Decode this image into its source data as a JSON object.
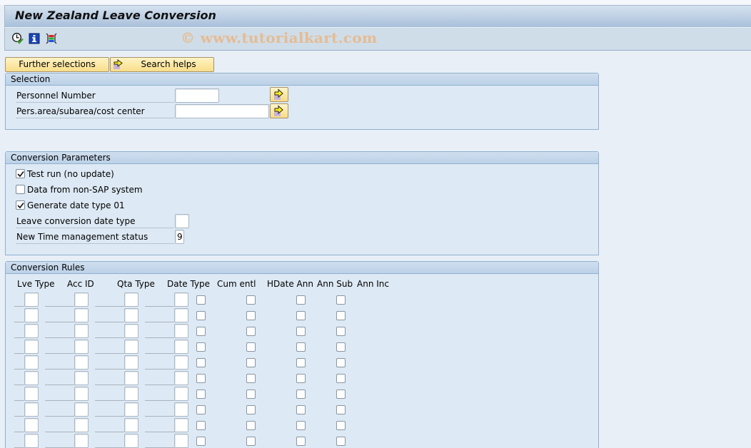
{
  "window": {
    "title": "New Zealand Leave Conversion",
    "watermark": "© www.tutorialkart.com"
  },
  "toolbar": {
    "icons": [
      {
        "name": "execute-icon",
        "tooltip": ""
      },
      {
        "name": "info-icon",
        "tooltip": ""
      },
      {
        "name": "selection-screen-icon",
        "tooltip": ""
      }
    ]
  },
  "buttons": {
    "further_selections": "Further selections",
    "search_helps": "Search helps"
  },
  "selection": {
    "title": "Selection",
    "fields": [
      {
        "label": "Personnel Number",
        "value": ""
      },
      {
        "label": "Pers.area/subarea/cost center",
        "value": ""
      }
    ]
  },
  "conversion_parameters": {
    "title": "Conversion Parameters",
    "checkboxes": [
      {
        "label": "Test run (no update)",
        "checked": true
      },
      {
        "label": "Data from non-SAP system",
        "checked": false
      },
      {
        "label": "Generate date type 01",
        "checked": true
      }
    ],
    "fields": [
      {
        "label": "Leave conversion date type",
        "value": ""
      },
      {
        "label": "New Time management status",
        "value": "9"
      }
    ]
  },
  "conversion_rules": {
    "title": "Conversion Rules",
    "columns": [
      "Lve Type",
      "Acc ID",
      "Qta Type",
      "Date Type",
      "Cum entl",
      "HDate Ann",
      "Ann Sub",
      "Ann Inc"
    ],
    "rows": [
      {
        "lve_type": "",
        "acc_id": "",
        "qta_type": "",
        "date_type": "",
        "cum_entl": false,
        "hdate_ann": false,
        "ann_sub": false,
        "ann_inc": false
      },
      {
        "lve_type": "",
        "acc_id": "",
        "qta_type": "",
        "date_type": "",
        "cum_entl": false,
        "hdate_ann": false,
        "ann_sub": false,
        "ann_inc": false
      },
      {
        "lve_type": "",
        "acc_id": "",
        "qta_type": "",
        "date_type": "",
        "cum_entl": false,
        "hdate_ann": false,
        "ann_sub": false,
        "ann_inc": false
      },
      {
        "lve_type": "",
        "acc_id": "",
        "qta_type": "",
        "date_type": "",
        "cum_entl": false,
        "hdate_ann": false,
        "ann_sub": false,
        "ann_inc": false
      },
      {
        "lve_type": "",
        "acc_id": "",
        "qta_type": "",
        "date_type": "",
        "cum_entl": false,
        "hdate_ann": false,
        "ann_sub": false,
        "ann_inc": false
      },
      {
        "lve_type": "",
        "acc_id": "",
        "qta_type": "",
        "date_type": "",
        "cum_entl": false,
        "hdate_ann": false,
        "ann_sub": false,
        "ann_inc": false
      },
      {
        "lve_type": "",
        "acc_id": "",
        "qta_type": "",
        "date_type": "",
        "cum_entl": false,
        "hdate_ann": false,
        "ann_sub": false,
        "ann_inc": false
      },
      {
        "lve_type": "",
        "acc_id": "",
        "qta_type": "",
        "date_type": "",
        "cum_entl": false,
        "hdate_ann": false,
        "ann_sub": false,
        "ann_inc": false
      },
      {
        "lve_type": "",
        "acc_id": "",
        "qta_type": "",
        "date_type": "",
        "cum_entl": false,
        "hdate_ann": false,
        "ann_sub": false,
        "ann_inc": false
      },
      {
        "lve_type": "",
        "acc_id": "",
        "qta_type": "",
        "date_type": "",
        "cum_entl": false,
        "hdate_ann": false,
        "ann_sub": false,
        "ann_inc": false
      }
    ]
  },
  "colors": {
    "title_gradient_top": "#d5e2ef",
    "title_gradient_bottom": "#a9c0da",
    "toolbar_bg": "#cfdde9",
    "page_bg": "#e8eff7",
    "group_bg": "#dde9f4",
    "button_yellow": "#f8de8a"
  }
}
